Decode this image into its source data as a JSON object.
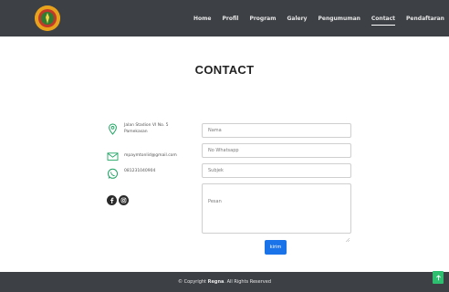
{
  "nav": {
    "logo_icon": "school-emblem-logo",
    "items": [
      {
        "label": "Home"
      },
      {
        "label": "Profil"
      },
      {
        "label": "Program"
      },
      {
        "label": "Galery"
      },
      {
        "label": "Pengumuman"
      },
      {
        "label": "Contact",
        "active": true
      },
      {
        "label": "Pendaftaran"
      }
    ]
  },
  "page": {
    "title": "CONTACT"
  },
  "contact": {
    "address_line1": "Jalan Stadion VI No. 5",
    "address_line2": "Pamekasan",
    "email": "mpaymtonlid@gmail.com",
    "phone": "081231040904",
    "icons": {
      "address": "map-pin-icon",
      "email": "envelope-icon",
      "phone": "whatsapp-icon"
    }
  },
  "social": [
    {
      "icon": "facebook-icon"
    },
    {
      "icon": "instagram-icon"
    }
  ],
  "form": {
    "nama_placeholder": "Nama",
    "whatsapp_placeholder": "No Whatsapp",
    "subjek_placeholder": "Subjek",
    "pesan_placeholder": "Pesan",
    "submit_label": "kirim"
  },
  "footer": {
    "prefix": "© Copyright ",
    "brand": "Regna",
    "suffix": ". All Rights Reserved"
  },
  "colors": {
    "nav_bg": "#3d4045",
    "accent_blue": "#1a73e8",
    "accent_green": "#2dbe70",
    "icon_green": "#1fa463",
    "logo_orange": "#e8a21b"
  },
  "back_to_top": {
    "icon": "arrow-up-icon"
  }
}
